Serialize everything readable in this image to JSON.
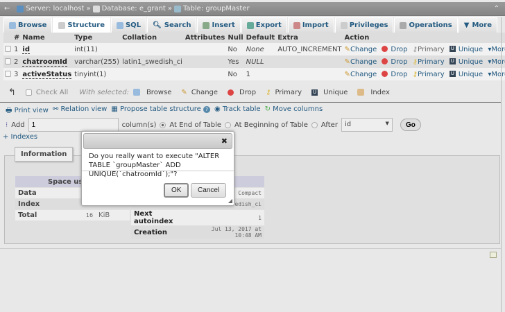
{
  "breadcrumb": {
    "server": "Server: localhost",
    "database": "Database: e_grant",
    "table": "Table: groupMaster",
    "sep": "»"
  },
  "tabs": [
    "Browse",
    "Structure",
    "SQL",
    "Search",
    "Insert",
    "Export",
    "Import",
    "Privileges",
    "Operations",
    "More"
  ],
  "columns": [
    "#",
    "Name",
    "Type",
    "Collation",
    "Attributes",
    "Null",
    "Default",
    "Extra",
    "Action"
  ],
  "rows": [
    {
      "num": "1",
      "name": "id",
      "type": "int(11)",
      "collation": "",
      "attributes": "",
      "null": "No",
      "default": "None",
      "extra": "AUTO_INCREMENT"
    },
    {
      "num": "2",
      "name": "chatroomId",
      "type": "varchar(255)",
      "collation": "latin1_swedish_ci",
      "attributes": "",
      "null": "Yes",
      "default": "NULL",
      "extra": ""
    },
    {
      "num": "3",
      "name": "activeStatus",
      "type": "tinyint(1)",
      "collation": "",
      "attributes": "",
      "null": "No",
      "default": "1",
      "extra": ""
    }
  ],
  "row_actions": {
    "change": "Change",
    "drop": "Drop",
    "primary": "Primary",
    "unique": "Unique",
    "more": "More"
  },
  "with_selected": {
    "check_all": "Check All",
    "label": "With selected:",
    "browse": "Browse",
    "change": "Change",
    "drop": "Drop",
    "primary": "Primary",
    "unique": "Unique",
    "index": "Index"
  },
  "links": {
    "print": "Print view",
    "relation": "Relation view",
    "propose": "Propose table structure",
    "track": "Track table",
    "move": "Move columns"
  },
  "add": {
    "label": "Add",
    "count": "1",
    "columns": "column(s)",
    "end": "At End of Table",
    "beginning": "At Beginning of Table",
    "after": "After",
    "after_value": "id",
    "go": "Go"
  },
  "indexes": "+ Indexes",
  "info": {
    "legend": "Information",
    "space_usage": "Space usage",
    "data": "Data",
    "index": "Index",
    "total": "Total",
    "total_value": "16",
    "total_unit": "KiB",
    "format_val": "Compact",
    "collation_val": "edish_ci",
    "next_autoindex": "Next autoindex",
    "next_autoindex_val": "1",
    "creation": "Creation",
    "creation_val": "Jul 13, 2017 at 10:48 AM"
  },
  "dialog": {
    "message": "Do you really want to execute \"ALTER TABLE `groupMaster` ADD UNIQUE(`chatroomId`);\"?",
    "ok": "OK",
    "cancel": "Cancel",
    "close": "✖"
  }
}
